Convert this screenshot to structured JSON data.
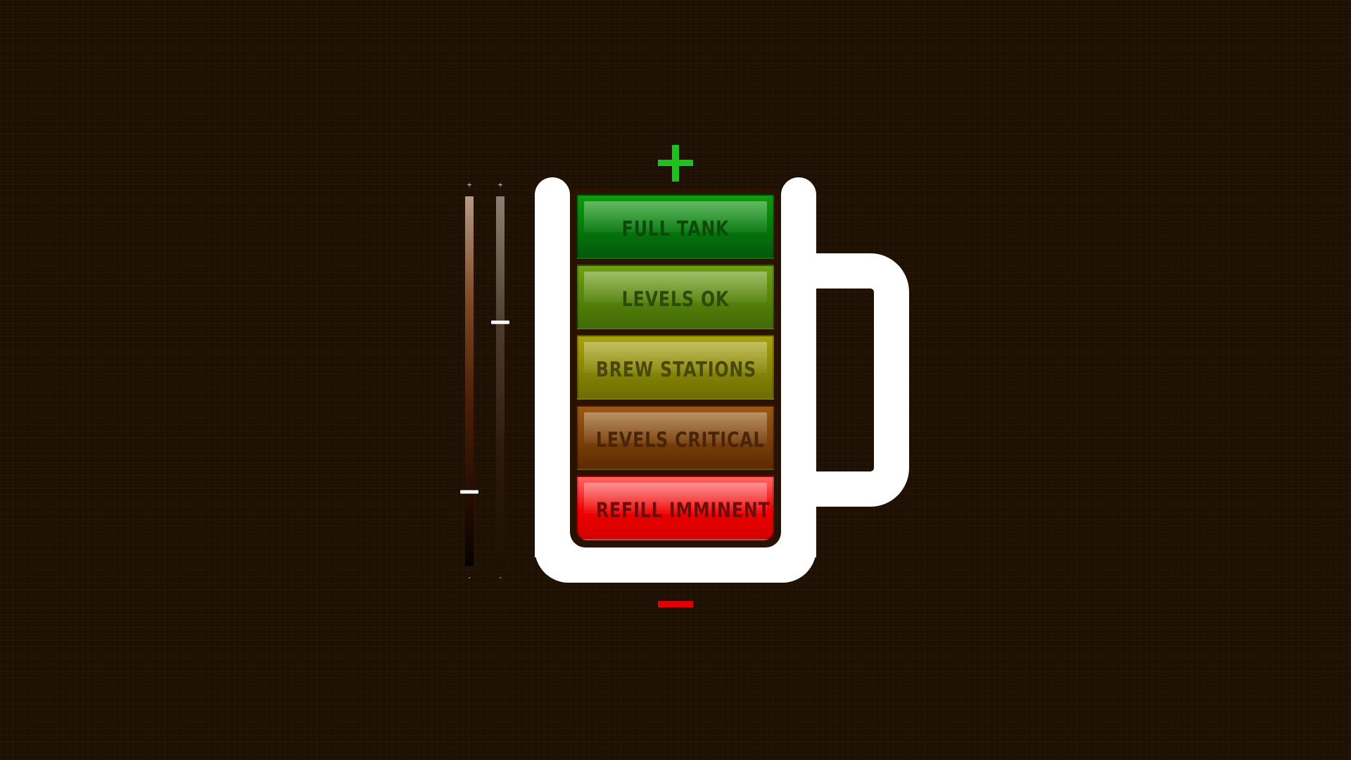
{
  "sliders": [
    {
      "name": "slider-a",
      "plus_label": "+",
      "minus_label": "-",
      "value": 0.8
    },
    {
      "name": "slider-b",
      "plus_label": "+",
      "minus_label": "-",
      "value": 0.34
    }
  ],
  "levels": [
    {
      "id": "full",
      "label": "FULL TANK"
    },
    {
      "id": "ok",
      "label": "LEVELS OK"
    },
    {
      "id": "brew",
      "label": "BREW STATIONS"
    },
    {
      "id": "critical",
      "label": "LEVELS CRITICAL"
    },
    {
      "id": "refill",
      "label": "REFILL IMMINENT"
    }
  ],
  "colors": {
    "background": "#1e1003",
    "mug": "#ffffff",
    "plus": "#1ec11e",
    "minus": "#e00000"
  },
  "icons": {
    "plus": "plus-icon",
    "minus": "minus-icon",
    "mug": "mug-icon"
  }
}
